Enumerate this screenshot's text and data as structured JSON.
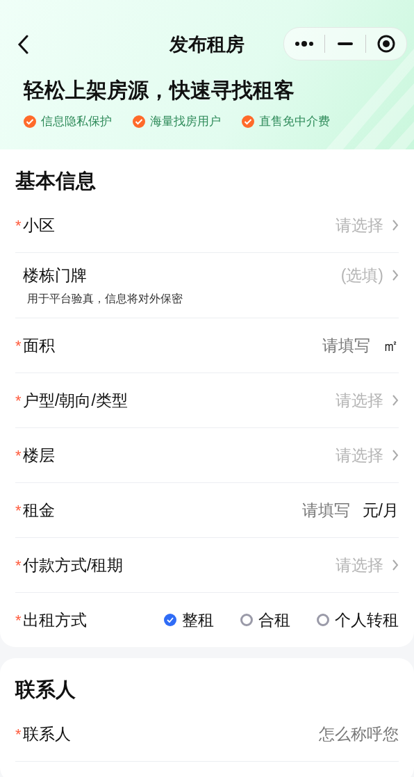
{
  "nav": {
    "title": "发布租房"
  },
  "banner": {
    "headline": "轻松上架房源，快速寻找租客",
    "features": [
      "信息隐私保护",
      "海量找房用户",
      "直售免中介费"
    ]
  },
  "sections": [
    {
      "title": "基本信息",
      "rows": [
        {
          "kind": "select",
          "mark": "*",
          "label": "小区",
          "placeholder": "请选择"
        },
        {
          "kind": "select",
          "label": "楼栋门牌",
          "placeholder": "(选填)",
          "hint": "用于平台验真，信息将对外保密"
        },
        {
          "kind": "input",
          "mark": "*",
          "label": "面积",
          "placeholder": "请填写",
          "unit": "㎡"
        },
        {
          "kind": "select",
          "mark": "*",
          "label": "户型/朝向/类型",
          "placeholder": "请选择"
        },
        {
          "kind": "select",
          "mark": "*",
          "label": "楼层",
          "placeholder": "请选择"
        },
        {
          "kind": "input",
          "mark": "*",
          "label": "租金",
          "placeholder": "请填写",
          "unit": "元/月"
        },
        {
          "kind": "select",
          "mark": "*",
          "label": "付款方式/租期",
          "placeholder": "请选择"
        },
        {
          "kind": "radio",
          "mark": "*",
          "label": "出租方式",
          "options": [
            {
              "label": "整租",
              "selected": true
            },
            {
              "label": "合租",
              "selected": false
            },
            {
              "label": "个人转租",
              "selected": false
            }
          ]
        }
      ]
    },
    {
      "title": "联系人",
      "rows": [
        {
          "kind": "input",
          "mark": "*",
          "label": "联系人",
          "placeholder": "怎么称呼您"
        }
      ]
    }
  ]
}
